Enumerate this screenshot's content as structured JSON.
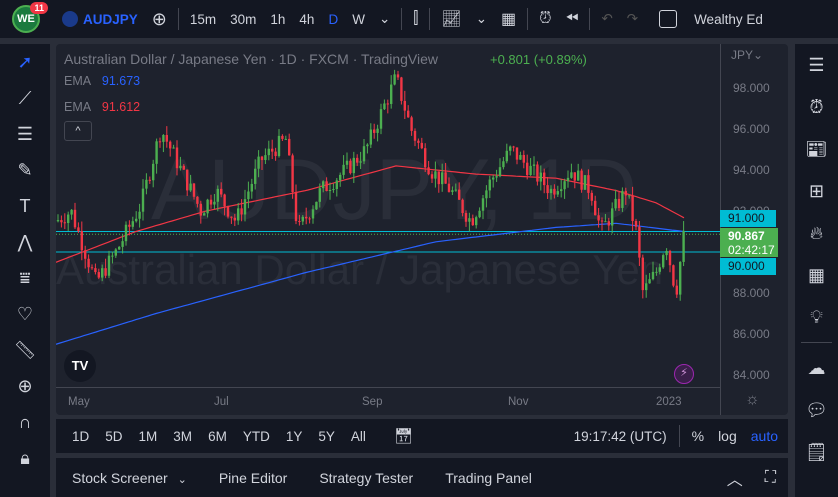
{
  "topbar": {
    "notif": "11",
    "symbol": "AUDJPY",
    "intervals": [
      "15m",
      "30m",
      "1h",
      "4h",
      "D",
      "W"
    ],
    "active_interval": "D",
    "account": "Wealthy Ed"
  },
  "legend": {
    "title": "Australian Dollar / Japanese Yen · 1D · FXCM · TradingView",
    "change": "+0.801 (+0.89%)",
    "ema1_label": "EMA",
    "ema1": "91.673",
    "ema2_label": "EMA",
    "ema2": "91.612"
  },
  "watermark": {
    "big": "AUDJPY, 1D",
    "small": "Australian Dollar / Japanese Yen"
  },
  "axis": {
    "currency": "JPY",
    "prices": [
      "98.000",
      "96.000",
      "94.000",
      "92.000",
      "88.000",
      "86.000",
      "84.000"
    ],
    "badge_upper": "91.000",
    "badge_lower": "90.000",
    "last": "90.867",
    "countdown": "02:42:17"
  },
  "time_labels": [
    "May",
    "Jul",
    "Sep",
    "Nov",
    "2023"
  ],
  "bottombar": {
    "ranges": [
      "1D",
      "5D",
      "1M",
      "3M",
      "6M",
      "YTD",
      "1Y",
      "5Y",
      "All"
    ],
    "clock": "19:17:42 (UTC)",
    "pct": "%",
    "log": "log",
    "auto": "auto"
  },
  "tabs": [
    "Stock Screener",
    "Pine Editor",
    "Strategy Tester",
    "Trading Panel"
  ],
  "colors": {
    "up": "#4caf50",
    "down": "#f23645",
    "ema_red": "#f23645",
    "ema_blue": "#2962ff",
    "line": "#00bcd4"
  },
  "price_path": [
    [
      0,
      91.5
    ],
    [
      15,
      92
    ],
    [
      40,
      88.5
    ],
    [
      60,
      90
    ],
    [
      85,
      92.3
    ],
    [
      105,
      96
    ],
    [
      125,
      94
    ],
    [
      145,
      92
    ],
    [
      160,
      93
    ],
    [
      180,
      91.5
    ],
    [
      205,
      94.5
    ],
    [
      230,
      95.5
    ],
    [
      242,
      91
    ],
    [
      265,
      93
    ],
    [
      290,
      94
    ],
    [
      310,
      95
    ],
    [
      340,
      98.5
    ],
    [
      355,
      96
    ],
    [
      375,
      94
    ],
    [
      395,
      93
    ],
    [
      415,
      91.5
    ],
    [
      435,
      93.5
    ],
    [
      455,
      95
    ],
    [
      475,
      94
    ],
    [
      495,
      93
    ],
    [
      515,
      94
    ],
    [
      535,
      93
    ],
    [
      545,
      91
    ],
    [
      570,
      93
    ],
    [
      580,
      91
    ],
    [
      587,
      88
    ],
    [
      600,
      89
    ],
    [
      610,
      90.5
    ],
    [
      620,
      88
    ],
    [
      628,
      90.87
    ]
  ],
  "ema_red": [
    [
      0,
      89.5
    ],
    [
      80,
      91
    ],
    [
      150,
      92
    ],
    [
      250,
      93
    ],
    [
      340,
      94.2
    ],
    [
      420,
      93.8
    ],
    [
      500,
      93.6
    ],
    [
      560,
      93
    ],
    [
      600,
      92.4
    ],
    [
      628,
      91.67
    ]
  ],
  "ema_blue": [
    [
      0,
      85.5
    ],
    [
      100,
      87
    ],
    [
      250,
      89
    ],
    [
      380,
      90.5
    ],
    [
      500,
      91.2
    ],
    [
      560,
      91.4
    ],
    [
      628,
      91.0
    ]
  ]
}
